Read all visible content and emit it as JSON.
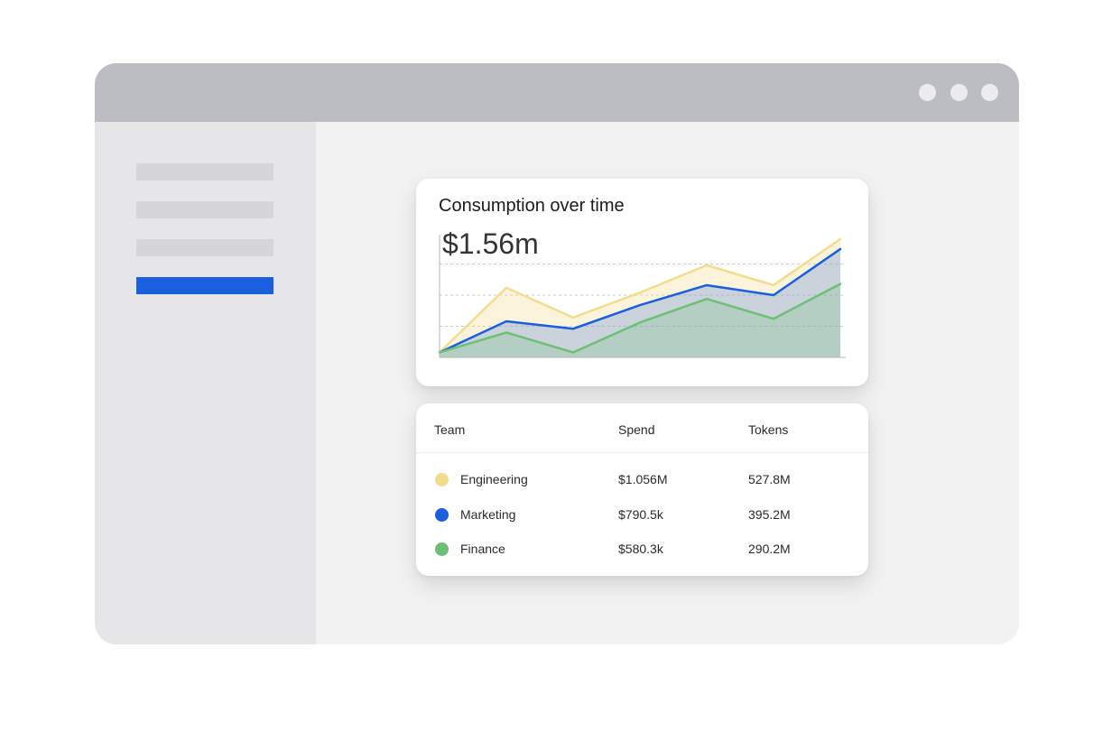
{
  "colors": {
    "engineering": "#f3dc8c",
    "marketing": "#1a5fe0",
    "finance": "#6cc073",
    "sidebar_active": "#1a5fe0"
  },
  "window": {
    "controls": [
      "dot",
      "dot",
      "dot"
    ]
  },
  "chart_card": {
    "title": "Consumption over time",
    "total": "$1.56m"
  },
  "chart_data": {
    "type": "area",
    "title": "Consumption over time",
    "xlabel": "",
    "ylabel": "",
    "grid": true,
    "x": [
      0,
      1,
      2,
      3,
      4,
      5,
      6
    ],
    "ylim": [
      0,
      1
    ],
    "series": [
      {
        "name": "Engineering",
        "color": "#f3dc8c",
        "values": [
          0.04,
          0.56,
          0.32,
          0.52,
          0.74,
          0.58,
          0.95
        ]
      },
      {
        "name": "Marketing",
        "color": "#1a5fe0",
        "values": [
          0.04,
          0.29,
          0.23,
          0.42,
          0.58,
          0.5,
          0.87
        ]
      },
      {
        "name": "Finance",
        "color": "#6cc073",
        "values": [
          0.04,
          0.2,
          0.04,
          0.28,
          0.47,
          0.31,
          0.59
        ]
      }
    ]
  },
  "table": {
    "headers": {
      "team": "Team",
      "spend": "Spend",
      "tokens": "Tokens"
    },
    "rows": [
      {
        "team": "Engineering",
        "spend": "$1.056M",
        "tokens": "527.8M",
        "color": "#f3dc8c"
      },
      {
        "team": "Marketing",
        "spend": "$790.5k",
        "tokens": "395.2M",
        "color": "#1a5fe0"
      },
      {
        "team": "Finance",
        "spend": "$580.3k",
        "tokens": "290.2M",
        "color": "#6cc073"
      }
    ]
  }
}
